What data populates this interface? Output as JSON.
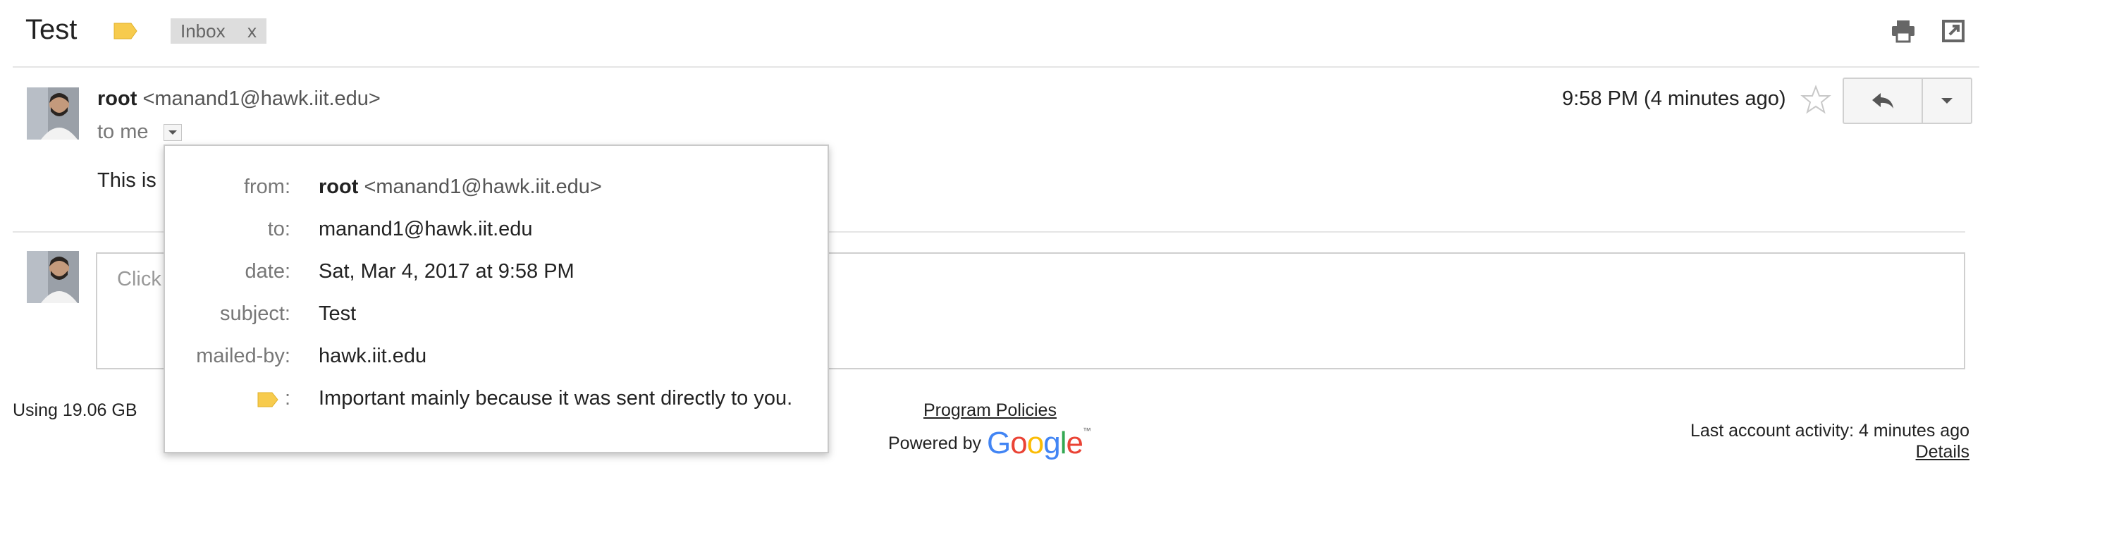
{
  "header": {
    "subject": "Test",
    "label_chip": "Inbox",
    "label_chip_remove": "x",
    "icons": [
      "importance-label-icon",
      "print-icon",
      "new-window-icon"
    ]
  },
  "message": {
    "sender_name": "root",
    "sender_email": "<manand1@hawk.iit.edu>",
    "to_line": "to me",
    "timestamp": "9:58 PM (4 minutes ago)",
    "body_preview": "This is"
  },
  "details_popup": {
    "from_label": "from:",
    "from_name": "root",
    "from_email": "<manand1@hawk.iit.edu>",
    "to_label": "to:",
    "to_value": "manand1@hawk.iit.edu",
    "date_label": "date:",
    "date_value": "Sat, Mar 4, 2017 at 9:58 PM",
    "subject_label": "subject:",
    "subject_value": "Test",
    "mailed_by_label": "mailed-by:",
    "mailed_by_value": "hawk.iit.edu",
    "importance_label_suffix": ":",
    "importance_value": "Important mainly because it was sent directly to you."
  },
  "reply_box": {
    "placeholder": "Click"
  },
  "footer": {
    "storage": "Using 19.06 GB",
    "program_policies": "Program Policies",
    "powered_by": "Powered by",
    "google_tm": "™",
    "last_activity": "Last account activity: 4 minutes ago",
    "details_link": "Details"
  },
  "colors": {
    "importance_yellow": "#f7cb4d",
    "chip_bg": "#dddddd",
    "google_blue": "#4285f4",
    "google_red": "#ea4335",
    "google_yellow": "#fbbc05",
    "google_green": "#34a853"
  }
}
